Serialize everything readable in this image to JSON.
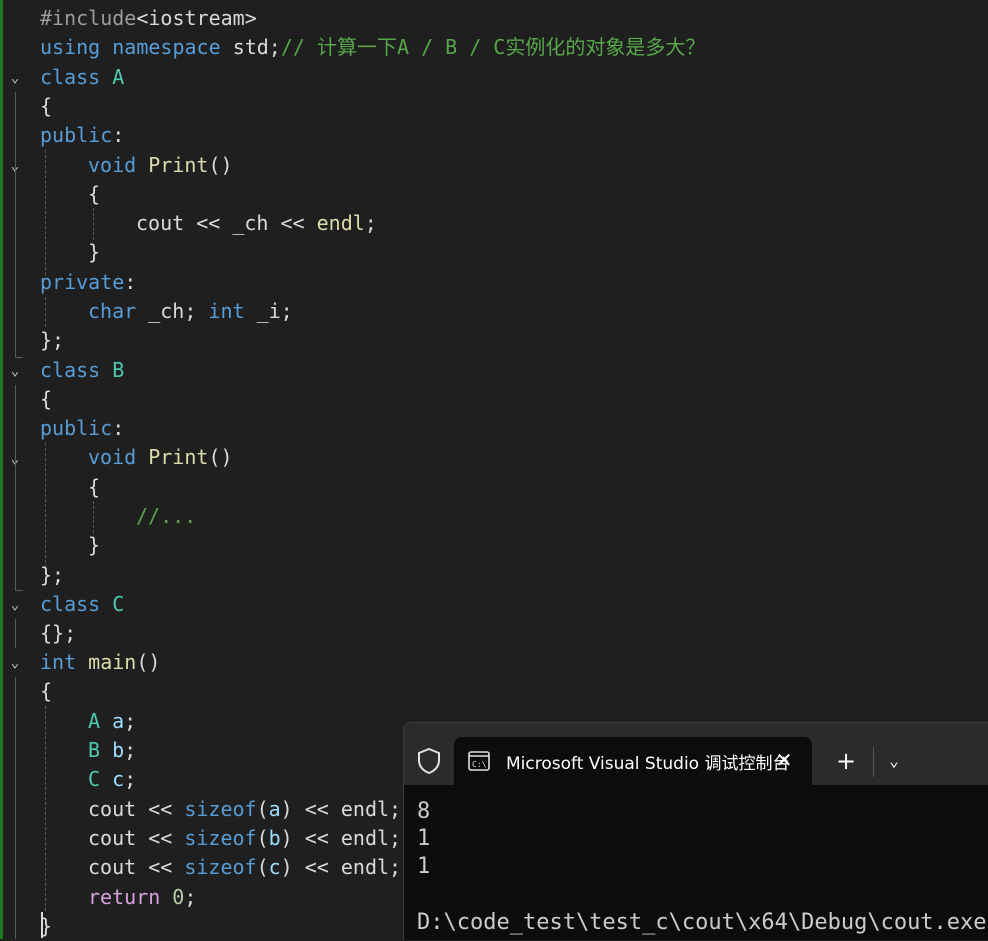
{
  "code": {
    "l1": {
      "pp": "#include",
      "hdr": "<iostream>"
    },
    "l2": {
      "kw1": "using",
      "kw2": "namespace",
      "id": "std;",
      "cm": "// 计算一下A / B / C实例化的对象是多大？"
    },
    "l3": {
      "kw": "class",
      "ty": "A"
    },
    "l4": "{",
    "l5": {
      "kw": "public",
      "p": ":"
    },
    "l6": {
      "kw": "void",
      "fn": "Print",
      "p": "()"
    },
    "l7": "{",
    "l8": {
      "a": "cout",
      "b": " << _ch << ",
      "c": "endl",
      "d": ";"
    },
    "l9": "}",
    "l10": {
      "kw": "private",
      "p": ":"
    },
    "l11": {
      "kw1": "char",
      "v1": " _ch; ",
      "kw2": "int",
      "v2": " _i;"
    },
    "l12": "};",
    "l13": {
      "kw": "class",
      "ty": "B"
    },
    "l14": "{",
    "l15": {
      "kw": "public",
      "p": ":"
    },
    "l16": {
      "kw": "void",
      "fn": "Print",
      "p": "()"
    },
    "l17": "{",
    "l18": "//...",
    "l19": "}",
    "l20": "};",
    "l21": {
      "kw": "class",
      "ty": "C"
    },
    "l22": "{};",
    "l23": {
      "kw": "int",
      "fn": "main",
      "p": "()"
    },
    "l24": "{",
    "l25": {
      "ty": "A",
      "v": "a",
      "p": ";"
    },
    "l26": {
      "ty": "B",
      "v": "b",
      "p": ";"
    },
    "l27": {
      "ty": "C",
      "v": "c",
      "p": ";"
    },
    "l28": {
      "a": "cout << ",
      "kw": "sizeof",
      "p1": "(",
      "v": "a",
      "p2": ")",
      "b": " << endl;"
    },
    "l29": {
      "a": "cout << ",
      "kw": "sizeof",
      "p1": "(",
      "v": "b",
      "p2": ")",
      "b": " << endl;"
    },
    "l30": {
      "a": "cout << ",
      "kw": "sizeof",
      "p1": "(",
      "v": "c",
      "p2": ")",
      "b": " << endl;"
    },
    "l31": {
      "kw": "return",
      "num": " 0",
      "p": ";"
    },
    "l32": "}"
  },
  "terminal": {
    "tab_title": "Microsoft Visual Studio 调试控制台",
    "close_glyph": "✕",
    "new_tab_glyph": "+",
    "dropdown_glyph": "⌄",
    "output": [
      "8",
      "1",
      "1",
      "",
      "D:\\code_test\\test_c\\cout\\x64\\Debug\\cout.exe"
    ]
  },
  "fold_glyph": "⌄",
  "colors": {
    "editor_bg": "#1f1f1f",
    "keyword": "#569cd6",
    "type": "#4ec9b0",
    "function": "#dcdcaa",
    "comment": "#57a64a",
    "control": "#d8a0df",
    "terminal_bg": "#0c0c0c"
  }
}
